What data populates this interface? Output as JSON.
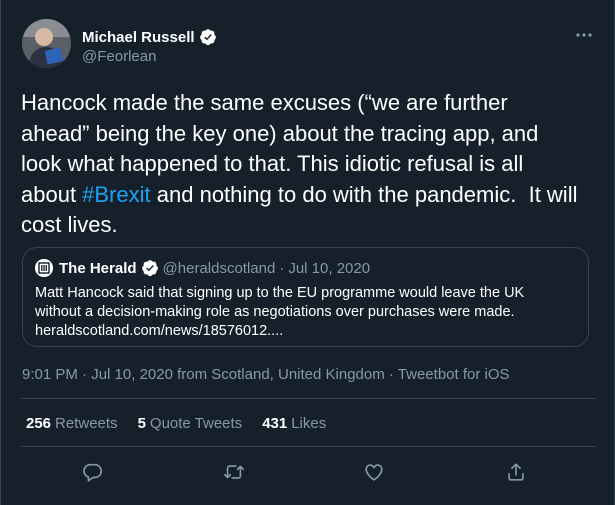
{
  "author": {
    "display_name": "Michael Russell",
    "handle": "@Feorlean"
  },
  "tweet": {
    "text_before": "Hancock made the same excuses (“we are further ahead” being the key one) about the tracing app, and look what happened to that. This idiotic refusal is all about ",
    "hashtag": "#Brexit",
    "text_after": " and nothing to do with the pandemic.  It will cost lives."
  },
  "quoted": {
    "name": "The Herald",
    "handle": "@heraldscotland",
    "separator": "·",
    "date": "Jul 10, 2020",
    "text_line1": "Matt Hancock said that signing up to the EU programme would leave the UK",
    "text_line2": "without a decision-making role as negotiations over purchases were made.",
    "text_line3": "heraldscotland.com/news/18576012...."
  },
  "meta": {
    "time": "9:01 PM",
    "sep1": " · ",
    "date_location": "Jul 10, 2020 from Scotland, United Kingdom",
    "sep2": " · ",
    "client": "Tweetbot for iOS"
  },
  "stats": {
    "retweets_count": "256",
    "retweets_label": "Retweets",
    "quotes_count": "5",
    "quotes_label": "Quote Tweets",
    "likes_count": "431",
    "likes_label": "Likes"
  },
  "icons": {
    "more": "more-dots-icon",
    "reply": "reply-icon",
    "retweet": "retweet-icon",
    "like": "like-icon",
    "share": "share-icon",
    "verified": "verified-badge-icon"
  },
  "colors": {
    "background": "#15202b",
    "accent": "#1da1f2",
    "secondary_text": "#8899a6",
    "border": "#38444d"
  }
}
